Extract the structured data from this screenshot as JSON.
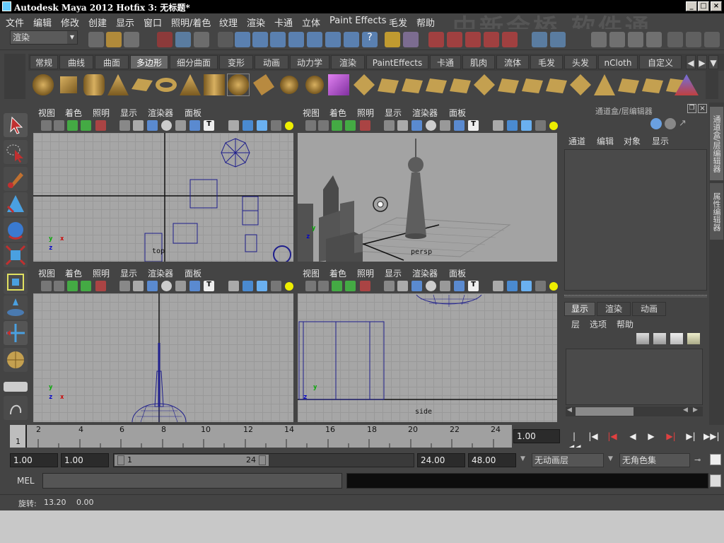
{
  "window": {
    "title": "Autodesk Maya 2012 Hotfix 3: 无标题*",
    "minimize": "_",
    "maximize": "□",
    "close": "×"
  },
  "menu": [
    "文件",
    "编辑",
    "修改",
    "创建",
    "显示",
    "窗口",
    "照明/着色",
    "纹理",
    "渲染",
    "卡通",
    "立体",
    "Paint Effects",
    "毛发",
    "帮助"
  ],
  "watermark": "中新金桥 软件通",
  "status_line": {
    "menu_set": "渲染"
  },
  "shelf": {
    "tabs": [
      "常规",
      "曲线",
      "曲面",
      "多边形",
      "细分曲面",
      "变形",
      "动画",
      "动力学",
      "渲染",
      "PaintEffects",
      "卡通",
      "肌肉",
      "流体",
      "毛发",
      "头发",
      "nCloth",
      "自定义"
    ],
    "active_tab": "多边形"
  },
  "viewport_menu": [
    "视图",
    "着色",
    "照明",
    "显示",
    "渲染器",
    "面板"
  ],
  "viewports": {
    "top": {
      "camera": "top"
    },
    "persp": {
      "camera": "persp"
    },
    "front": {
      "camera": ""
    },
    "side": {
      "camera": "side"
    }
  },
  "axes": {
    "x": "x",
    "y": "y",
    "z": "z"
  },
  "channel_box": {
    "title": "通道盒/层编辑器",
    "menu": [
      "通道",
      "编辑",
      "对象",
      "显示"
    ],
    "layer_tabs": [
      "显示",
      "渲染",
      "动画"
    ],
    "layer_menu": [
      "层",
      "选项",
      "帮助"
    ]
  },
  "side_tabs": [
    "通道盒/层编辑器",
    "属性编辑器"
  ],
  "timeline": {
    "ticks": [
      "2",
      "4",
      "6",
      "8",
      "10",
      "12",
      "14",
      "16",
      "18",
      "20",
      "22",
      "24"
    ],
    "start_label": "1",
    "current_frame": "1.00"
  },
  "range": {
    "start_time": "1.00",
    "playback_start": "1.00",
    "range_start": "1",
    "range_end": "24",
    "playback_end": "24.00",
    "end_time": "48.00",
    "anim_layer": "无动画层",
    "char_set": "无角色集"
  },
  "command_line": {
    "label": "MEL"
  },
  "help_line": {
    "label": "旋转:",
    "value1": "13.20",
    "value2": "0.00"
  },
  "colors": {
    "ui_bg": "#444444",
    "viewport_bg": "#a6a6a6",
    "wire": "#1e1e8c",
    "selected_tab": "#686868"
  }
}
